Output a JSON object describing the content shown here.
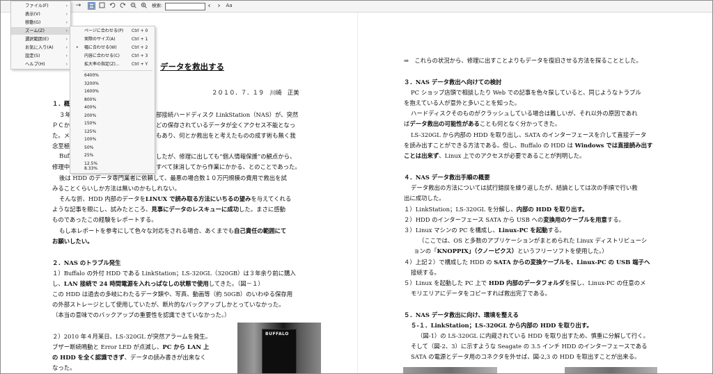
{
  "toolbar": {
    "forward_arrow": "→",
    "search_label": "検索:",
    "search_value": "",
    "prev_glyph": "‹",
    "next_glyph": "›",
    "font_glyph": "Aa",
    "icons": [
      "fit-width-icon",
      "fit-page-icon",
      "rotate-left-icon",
      "rotate-right-icon",
      "zoom-out-icon",
      "zoom-in-icon"
    ]
  },
  "menu": {
    "items": [
      {
        "label": "ファイル(F)",
        "arrow": "›"
      },
      {
        "label": "表示(V)",
        "arrow": "›"
      },
      {
        "label": "移動(G)",
        "arrow": "›"
      },
      {
        "label": "ズーム(Z)",
        "arrow": "›"
      },
      {
        "label": "選択範囲(E)",
        "arrow": "›"
      },
      {
        "label": "お気に入り(A)",
        "arrow": "›"
      },
      {
        "label": "設定(S)",
        "arrow": "›"
      },
      {
        "label": "ヘルプ(H)",
        "arrow": "›"
      }
    ]
  },
  "zoom_submenu": {
    "commands": [
      {
        "label": "ページに合わせる(P)",
        "shortcut": "Ctrl + 0",
        "checked": ""
      },
      {
        "label": "実際のサイズ(A)",
        "shortcut": "Ctrl + 1",
        "checked": ""
      },
      {
        "label": "幅に合わせる(W)",
        "shortcut": "Ctrl + 2",
        "checked": "•"
      },
      {
        "label": "内容に合わせる(C)",
        "shortcut": "Ctrl + 3",
        "checked": ""
      },
      {
        "label": "拡大率の指定(Z)...",
        "shortcut": "Ctrl + Y",
        "checked": ""
      }
    ],
    "levels": [
      "6400%",
      "3200%",
      "1600%",
      "800%",
      "400%",
      "200%",
      "150%",
      "125%",
      "100%",
      "50%",
      "25%",
      "12.5%",
      "8.33%"
    ]
  },
  "doc_left": {
    "title": "データを救出する",
    "date_author": "２０１０．７．１９　川崎　正美",
    "s1_heading": "１．概",
    "p1_line1_a": "３年",
    "p1_line1_b": "部接続ハードディスク LinkStation（NAS）が、突然",
    "p1_line2_a": "ＰＣか",
    "p1_line2_b": "どの保存されているデータが全くアクセス不能となっ",
    "p1_line3_a": "た。メ",
    "p1_line3_b": "もあり、何とか救出をと考えたものの成す術も無く我",
    "p1_line4": "念至極",
    "p2_line1_a": "Buff",
    "p2_line1_b": "したが、修理に出しても“個人情報保護”の観点から、",
    "p2_line2_a": "修理中",
    "p2_line2_b": "すべて抹消してから作業にかかる、とのことであった。",
    "p3_line1": "後は HDD のデータ専門業者に依頼して、最悪の場合数１０万円規模の費用で救出を試",
    "p3_line2": "みることくらいしか方法は無いのかもしれない。",
    "p4_line1_a": "そんな折、HDD 内部のデータを",
    "p4_line1_b": "LINUX で読み取る方法にいちるの望み",
    "p4_line1_c": "を与えてくれる",
    "p4_line2_a": "ような記事を眼にし、試みたところ、",
    "p4_line2_b": "見事にデータのレスキューに成功",
    "p4_line2_c": "した。まさに感動",
    "p4_line3": "ものであったこの経験をレポートする。",
    "p5_line1_a": "もし本レポートを参考にして色々な対応をされる場合、あくまでも",
    "p5_line1_b": "自己責任の範囲にて",
    "p5_line2": "お願いしたい。",
    "s2_heading": "２．NAS のトラブル発生",
    "s2_l1": "１）Buffalo の外付 HDD である LinkStation；LS-320GL（320GB）は３年余り前に購入",
    "s2_l2_a": "し、",
    "s2_l2_b": "LAN 接続で 24 時間電源を入れっぱなしの状態で使用",
    "s2_l2_c": "してきた。（図－１）",
    "s2_l3": "この HDD は過去の多岐にわたるデータ類や、写真、動画等（約 50GB）のいわゆる保存用",
    "s2_l4": "の外部ストレージとして使用していたが、断片的なバックアップしかとっていなかった。",
    "s2_l5": "（本当の意味でのバックアップの重要性を認識できていなかった。）",
    "s2_l6": "２）2010 年４月某日、LS-320GL が突然アラームを発生。",
    "s2_l7_a": "ブザー断続鳴動と Error LED が点滅し、",
    "s2_l7_b": "PC から LAN 上",
    "s2_l8_a": "の HDD を全く認識できず",
    "s2_l8_b": "、データの読み書きが出来なく",
    "s2_l9": "なった。",
    "photo_logo": "BUFFALO"
  },
  "doc_right": {
    "r_l1": "⇒　これらの状況から、修理に出すことよりもデータを復旧させる方法を探ることとした。",
    "r_s3": "３．NAS データ救出へ向けての検討",
    "r_l2": "PC ショップ店頭で相談したり Web での記事を色々探していると、同じようなトラブル",
    "r_l3": "を抱えている人が意外と多いことを知った。",
    "r_l4": "ハードディスクそのものがクラッシュしている場合は難しいが、それ以外の原因であれ",
    "r_l5_a": "ば",
    "r_l5_b": "データ救出の可能性がある",
    "r_l5_c": "ことも何となく分かってきた。",
    "r_l6": "LS-320GL から内部の HDD を取り出し、SATA のインターフェースを介して直接データ",
    "r_l7_a": "を読み出すことができる方法である。但し、Buffalo の HDD は ",
    "r_l7_b": "Windows では直接読み出す",
    "r_l8_a": "ことは出来ず",
    "r_l8_b": "、Linux 上でのアクセスが必要であることが判明した。",
    "r_s4": "４．NAS データ救出手順の概要",
    "r_l9": "データ救出の方法については試行錯誤を繰り返したが、結論としては次の手順で行い救",
    "r_l10": "出に成功した。",
    "r_l11_a": "１）LinkStation；LS-320GL を分解し、",
    "r_l11_b": "内部の HDD を取り出す。",
    "r_l12_a": "２）HDD のインターフェース SATA から USB への",
    "r_l12_b": "変換用のケーブルを用意",
    "r_l12_c": "する。",
    "r_l13_a": "３）Linux マシンの PC を構成し、",
    "r_l13_b": "Linux-PC を起動",
    "r_l13_c": "する。",
    "r_l14": "（ここでは、OS と多数のアプリケーションがまとめられた Linux ディストリビューシ",
    "r_l15_a": "ョンの「",
    "r_l15_b": "KNOPPIX」（クノーピクス）",
    "r_l15_c": "というフリーソフトを使用した。）",
    "r_l16_a": "４）上記２）で構成した HDD の ",
    "r_l16_b": "SATA からの変換ケーブルを、Linux-PC の USB 端子へ",
    "r_l17": "接続する。",
    "r_l18_a": "５）Linux を起動した PC 上で ",
    "r_l18_b": "HDD 内部のデータフォルダ",
    "r_l18_c": "を探し、Linux-PC の任意のメ",
    "r_l19": "モリエリアにデータをコピーすれば救出完了である。",
    "r_s5": "５．NAS データ救出に向け、環境を整える",
    "r_s51": "５‐１．LinkStation；LS-320GL から内部の HDD を取り出す。",
    "r_l20": "（図-1）の LS-320GL に内蔵されている HDD を取り出すため、慎重に分解して行く。",
    "r_l21": "そして（図-2、3）に示すような Seagate の 3.5 インチ HDD のインターフェースである",
    "r_l22": "SATA の電源とデータ用のコネクタを外せば、図-2,3 の HDD を取出すことが出来る。"
  }
}
